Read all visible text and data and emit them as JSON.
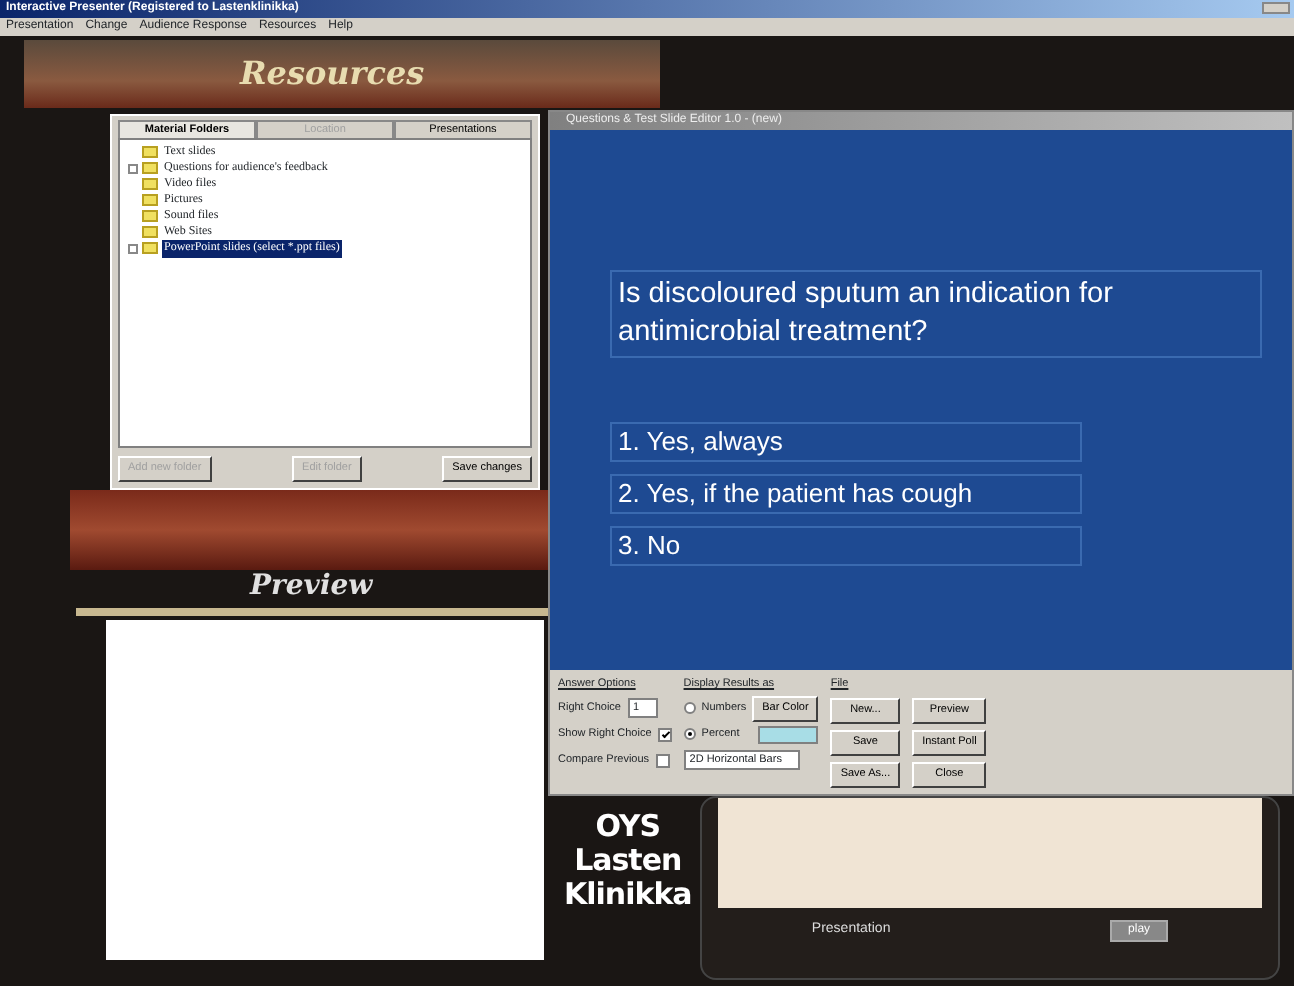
{
  "main_window": {
    "title": "Interactive Presenter (Registered to Lastenklinikka)",
    "menu": [
      "Presentation",
      "Change",
      "Audience Response",
      "Resources",
      "Help"
    ]
  },
  "resources": {
    "heading": "Resources",
    "tabs": [
      {
        "label": "Material Folders",
        "selected": true,
        "disabled": false
      },
      {
        "label": "Location",
        "selected": false,
        "disabled": true
      },
      {
        "label": "Presentations",
        "selected": false,
        "disabled": false
      }
    ],
    "folders": [
      {
        "label": "Text slides",
        "selected": false,
        "expandable": false
      },
      {
        "label": "Questions for audience's feedback",
        "selected": false,
        "expandable": true
      },
      {
        "label": "Video files",
        "selected": false,
        "expandable": false
      },
      {
        "label": "Pictures",
        "selected": false,
        "expandable": false
      },
      {
        "label": "Sound files",
        "selected": false,
        "expandable": false
      },
      {
        "label": "Web Sites",
        "selected": false,
        "expandable": false
      },
      {
        "label": "PowerPoint slides (select *.ppt files)",
        "selected": true,
        "expandable": true
      }
    ],
    "buttons": [
      {
        "label": "Add new folder",
        "disabled": true
      },
      {
        "label": "Edit folder",
        "disabled": true
      },
      {
        "label": "Save changes",
        "disabled": false
      }
    ]
  },
  "preview": {
    "heading": "Preview"
  },
  "editor": {
    "title": "Questions & Test Slide Editor 1.0 - (new)",
    "question": "Is discoloured sputum an indication for antimicrobial treatment?",
    "answers": [
      "1. Yes, always",
      "2. Yes, if the patient has cough",
      "3. No"
    ],
    "answer_options": {
      "heading": "Answer Options",
      "right_choice_label": "Right Choice",
      "right_choice": "1",
      "show_right_choice": {
        "label": "Show Right Choice",
        "checked": true
      },
      "compare_previous": {
        "label": "Compare Previous",
        "checked": false
      }
    },
    "display_results": {
      "heading": "Display Results as",
      "options": [
        {
          "label": "Numbers",
          "selected": false
        },
        {
          "label": "Percent",
          "selected": true
        }
      ],
      "bar_color_button": "Bar Color",
      "chart_style": "2D Horizontal Bars"
    },
    "file": {
      "heading": "File",
      "buttons": [
        "New...",
        "Preview",
        "Save",
        "Instant Poll",
        "Save As...",
        "Close"
      ]
    }
  },
  "logo": [
    "OYS",
    "Lasten",
    "Klinikka"
  ],
  "presentation": {
    "label": "Presentation",
    "play": "play"
  }
}
